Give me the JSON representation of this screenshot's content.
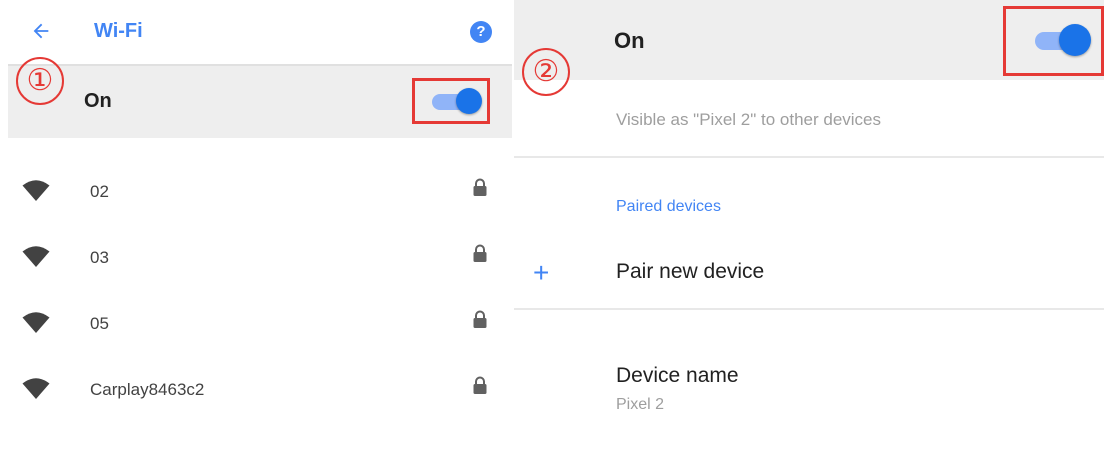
{
  "annotations": {
    "badge_1": "①",
    "badge_2": "②"
  },
  "colors": {
    "accent": "#4285f4",
    "toggle_thumb": "#1a73e8",
    "toggle_track": "#90b4f8",
    "highlight_red": "#e53935",
    "row_gray": "#eeeeee"
  },
  "wifi": {
    "header": {
      "back_icon": "arrow-left-icon",
      "title": "Wi-Fi",
      "help_icon": "question-circle-icon",
      "help_glyph": "?"
    },
    "on_row": {
      "label": "On",
      "toggle_on": true
    },
    "networks": [
      {
        "name": "02",
        "icon": "wifi-icon",
        "secured_icon": "lock-icon"
      },
      {
        "name": "03",
        "icon": "wifi-icon",
        "secured_icon": "lock-icon"
      },
      {
        "name": "05",
        "icon": "wifi-icon",
        "secured_icon": "lock-icon"
      },
      {
        "name": "Carplay8463c2",
        "icon": "wifi-icon",
        "secured_icon": "lock-icon"
      }
    ]
  },
  "bluetooth": {
    "on_row": {
      "label": "On",
      "toggle_on": true
    },
    "visible_text": "Visible as \"Pixel 2\" to other devices",
    "paired_devices_header": "Paired devices",
    "pair_new": {
      "icon": "plus-icon",
      "glyph": "+",
      "label": "Pair new device"
    },
    "device_name": {
      "label": "Device name",
      "value": "Pixel 2"
    }
  }
}
